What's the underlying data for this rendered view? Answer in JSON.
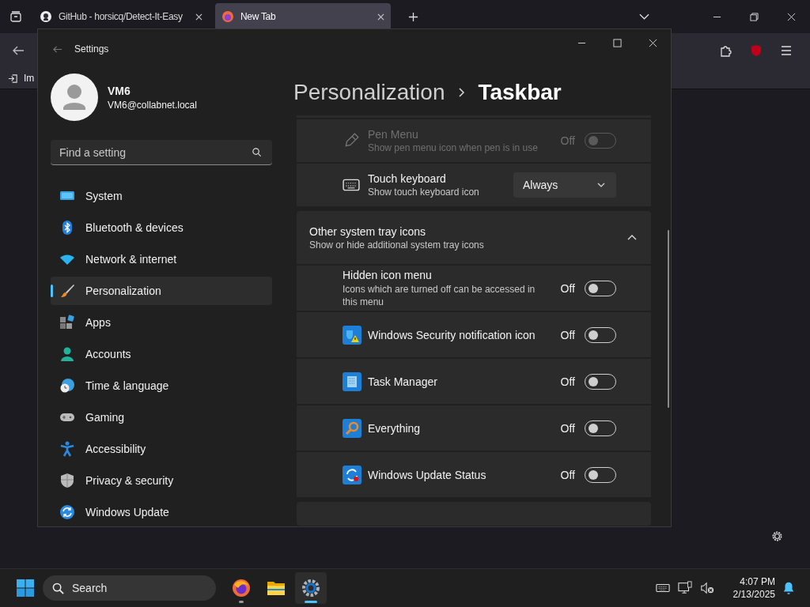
{
  "browser": {
    "tabs": [
      {
        "title": "GitHub - horsicq/Detect-It-Easy",
        "selected": false
      },
      {
        "title": "New Tab",
        "selected": true
      }
    ],
    "bookmarks": [
      "Im"
    ]
  },
  "settings": {
    "title": "Settings",
    "user": {
      "name": "VM6",
      "email": "VM6@collabnet.local"
    },
    "search": {
      "placeholder": "Find a setting"
    },
    "nav": [
      {
        "label": "System",
        "selected": false
      },
      {
        "label": "Bluetooth & devices",
        "selected": false
      },
      {
        "label": "Network & internet",
        "selected": false
      },
      {
        "label": "Personalization",
        "selected": true
      },
      {
        "label": "Apps",
        "selected": false
      },
      {
        "label": "Accounts",
        "selected": false
      },
      {
        "label": "Time & language",
        "selected": false
      },
      {
        "label": "Gaming",
        "selected": false
      },
      {
        "label": "Accessibility",
        "selected": false
      },
      {
        "label": "Privacy & security",
        "selected": false
      },
      {
        "label": "Windows Update",
        "selected": false
      }
    ],
    "breadcrumb": {
      "parent": "Personalization",
      "current": "Taskbar"
    },
    "rows": [
      {
        "kind": "toggle",
        "title": "Pen Menu",
        "description": "Show pen menu icon when pen is in use",
        "state_label": "Off",
        "on": false,
        "disabled": true
      },
      {
        "kind": "dropdown",
        "title": "Touch keyboard",
        "description": "Show touch keyboard icon",
        "value": "Always"
      }
    ],
    "section": {
      "title": "Other system tray icons",
      "description": "Show or hide additional system tray icons",
      "expanded": true,
      "rows": [
        {
          "kind": "toggle",
          "title": "Hidden icon menu",
          "description": "Icons which are turned off can be accessed in this menu",
          "state_label": "Off",
          "on": false,
          "disabled": false
        },
        {
          "kind": "toggle",
          "title": "Windows Security notification icon",
          "state_label": "Off",
          "on": false,
          "disabled": false
        },
        {
          "kind": "toggle",
          "title": "Task Manager",
          "state_label": "Off",
          "on": false,
          "disabled": false
        },
        {
          "kind": "toggle",
          "title": "Everything",
          "state_label": "Off",
          "on": false,
          "disabled": false
        },
        {
          "kind": "toggle",
          "title": "Windows Update Status",
          "state_label": "Off",
          "on": false,
          "disabled": false
        }
      ]
    }
  },
  "taskbar": {
    "search": {
      "placeholder": "Search"
    },
    "apps": [
      {
        "running": true,
        "selected": false
      },
      {
        "running": false,
        "selected": false
      },
      {
        "running": true,
        "selected": true
      }
    ],
    "time": "4:07 PM",
    "date": "2/13/2025"
  }
}
